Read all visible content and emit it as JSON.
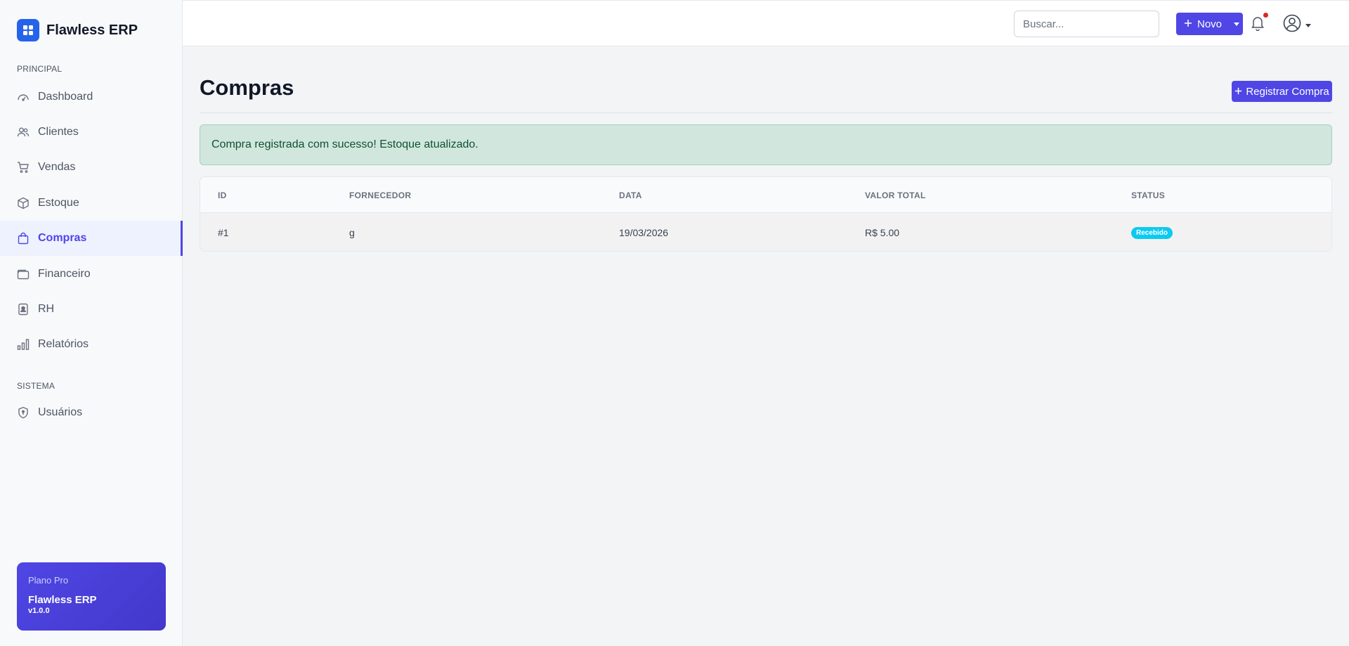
{
  "brand": {
    "name": "Flawless ERP"
  },
  "sidebar": {
    "sections": [
      {
        "title": "PRINCIPAL"
      },
      {
        "title": "SISTEMA"
      }
    ],
    "items": [
      {
        "label": "Dashboard",
        "icon": "dashboard-icon"
      },
      {
        "label": "Clientes",
        "icon": "users-icon"
      },
      {
        "label": "Vendas",
        "icon": "cart-icon"
      },
      {
        "label": "Estoque",
        "icon": "box-icon"
      },
      {
        "label": "Compras",
        "icon": "bag-icon",
        "active": true
      },
      {
        "label": "Financeiro",
        "icon": "wallet-icon"
      },
      {
        "label": "RH",
        "icon": "badge-icon"
      },
      {
        "label": "Relatórios",
        "icon": "bar-chart-icon"
      },
      {
        "label": "Usuários",
        "icon": "shield-icon"
      }
    ],
    "plan": {
      "label": "Plano Pro",
      "name": "Flawless ERP",
      "version": "v1.0.0"
    }
  },
  "topbar": {
    "search_placeholder": "Buscar...",
    "new_label": "Novo"
  },
  "main": {
    "title": "Compras",
    "register_label": "Registrar Compra",
    "alert": "Compra registrada com sucesso! Estoque atualizado.",
    "table": {
      "columns": [
        "ID",
        "FORNECEDOR",
        "DATA",
        "VALOR TOTAL",
        "STATUS"
      ],
      "rows": [
        {
          "id": "#1",
          "supplier": "g",
          "date": "19/03/2026",
          "total": "R$ 5.00",
          "status": "Recebido"
        }
      ]
    }
  },
  "colors": {
    "accent": "#4f46e5",
    "brand_logo": "#2563eb",
    "alert_bg": "#d1e7dd",
    "status_badge": "#0dcaf0",
    "notification_dot": "#dc2626"
  }
}
